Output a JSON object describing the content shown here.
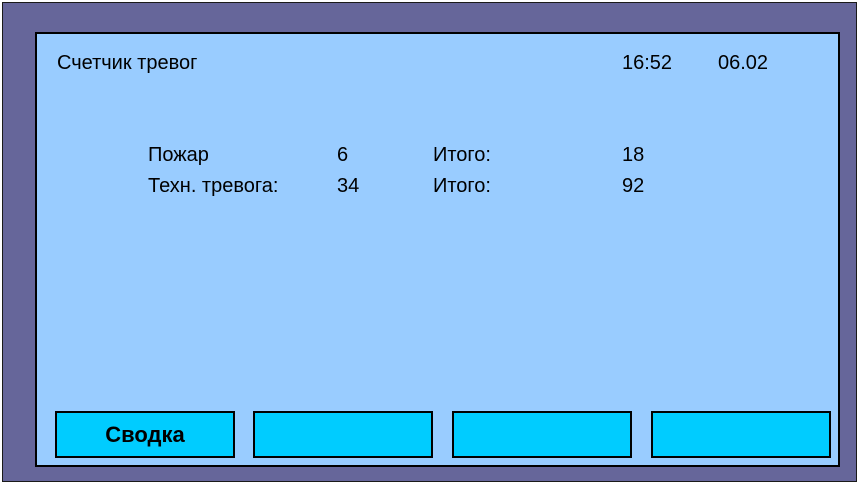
{
  "header": {
    "title": "Счетчик тревог",
    "time": "16:52",
    "date": "06.02"
  },
  "counters": [
    {
      "label": "Пожар",
      "value": "6",
      "total_label": "Итого:",
      "total_value": "18"
    },
    {
      "label": "Техн. тревога:",
      "value": "34",
      "total_label": "Итого:",
      "total_value": "92"
    }
  ],
  "softkeys": [
    {
      "label": "Сводка"
    },
    {
      "label": ""
    },
    {
      "label": ""
    },
    {
      "label": ""
    }
  ],
  "colors": {
    "frame": "#66669a",
    "screen": "#99ccff",
    "softkey": "#00ccff"
  }
}
